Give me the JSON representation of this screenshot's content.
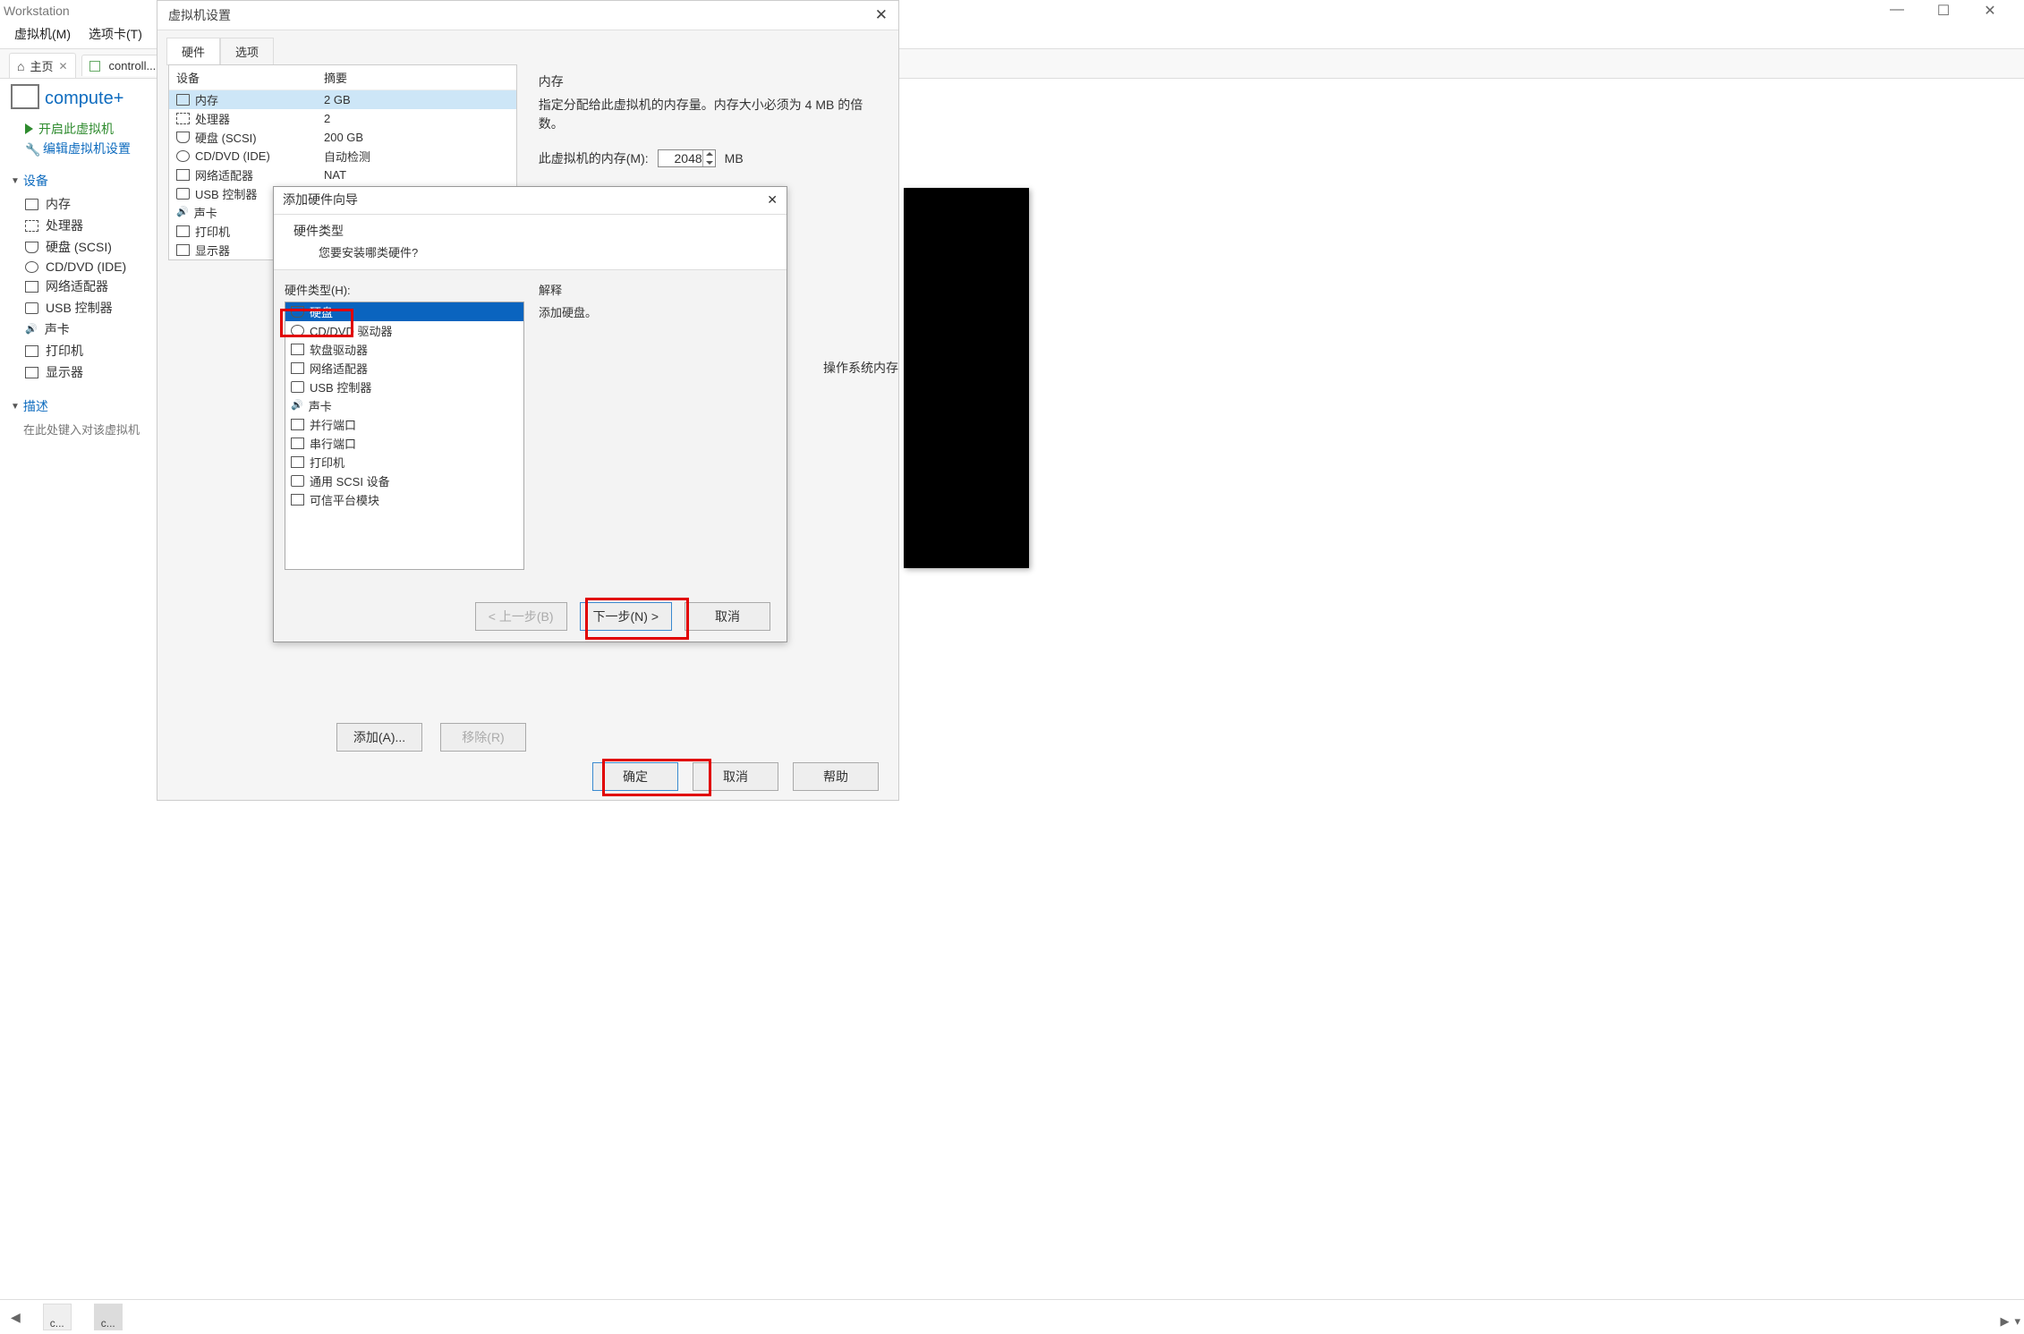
{
  "app": {
    "title": "Workstation",
    "menus": [
      "虚拟机(M)",
      "选项卡(T)"
    ]
  },
  "tabs": {
    "home": "主页",
    "controller": "controller",
    "controller_short": "controll..."
  },
  "sidebar": {
    "vm_name": "compute+",
    "power_on": "开启此虚拟机",
    "edit_settings": "编辑虚拟机设置",
    "devices_header": "设备",
    "devices": {
      "memory": "内存",
      "cpu": "处理器",
      "disk": "硬盘 (SCSI)",
      "cd": "CD/DVD (IDE)",
      "net": "网络适配器",
      "usb": "USB 控制器",
      "sound": "声卡",
      "printer": "打印机",
      "display": "显示器"
    },
    "desc_header": "描述",
    "desc_hint": "在此处键入对该虚拟机"
  },
  "settings": {
    "title": "虚拟机设置",
    "tab_hw": "硬件",
    "tab_opt": "选项",
    "col_device": "设备",
    "col_summary": "摘要",
    "rows": {
      "memory_label": "内存",
      "memory_val": "2 GB",
      "cpu_label": "处理器",
      "cpu_val": "2",
      "disk_label": "硬盘 (SCSI)",
      "disk_val": "200 GB",
      "cd_label": "CD/DVD (IDE)",
      "cd_val": "自动检测",
      "net_label": "网络适配器",
      "net_val": "NAT",
      "usb_label": "USB 控制器",
      "usb_val": "",
      "sound_label": "声卡",
      "sound_val": "",
      "printer_label": "打印机",
      "printer_val": "",
      "display_label": "显示器",
      "display_val": ""
    },
    "mem": {
      "title": "内存",
      "desc": "指定分配给此虚拟机的内存量。内存大小必须为 4 MB 的倍数。",
      "label": "此虚拟机的内存(M):",
      "value": "2048",
      "unit": "MB"
    },
    "os_note": "操作系统内存",
    "add_btn": "添加(A)...",
    "remove_btn": "移除(R)",
    "ok": "确定",
    "cancel": "取消",
    "help": "帮助"
  },
  "wizard": {
    "title": "添加硬件向导",
    "head1": "硬件类型",
    "head2": "您要安装哪类硬件?",
    "list_label": "硬件类型(H):",
    "items": {
      "hdd": "硬盘",
      "cd": "CD/DVD 驱动器",
      "floppy": "软盘驱动器",
      "net": "网络适配器",
      "usb": "USB 控制器",
      "sound": "声卡",
      "par": "并行端口",
      "ser": "串行端口",
      "printer": "打印机",
      "scsi": "通用 SCSI 设备",
      "tpm": "可信平台模块"
    },
    "explain_label": "解释",
    "explain_text": "添加硬盘。",
    "prev": "< 上一步(B)",
    "next": "下一步(N) >",
    "cancel": "取消"
  },
  "footer": {
    "thumb1": "c...",
    "thumb2": "c..."
  }
}
